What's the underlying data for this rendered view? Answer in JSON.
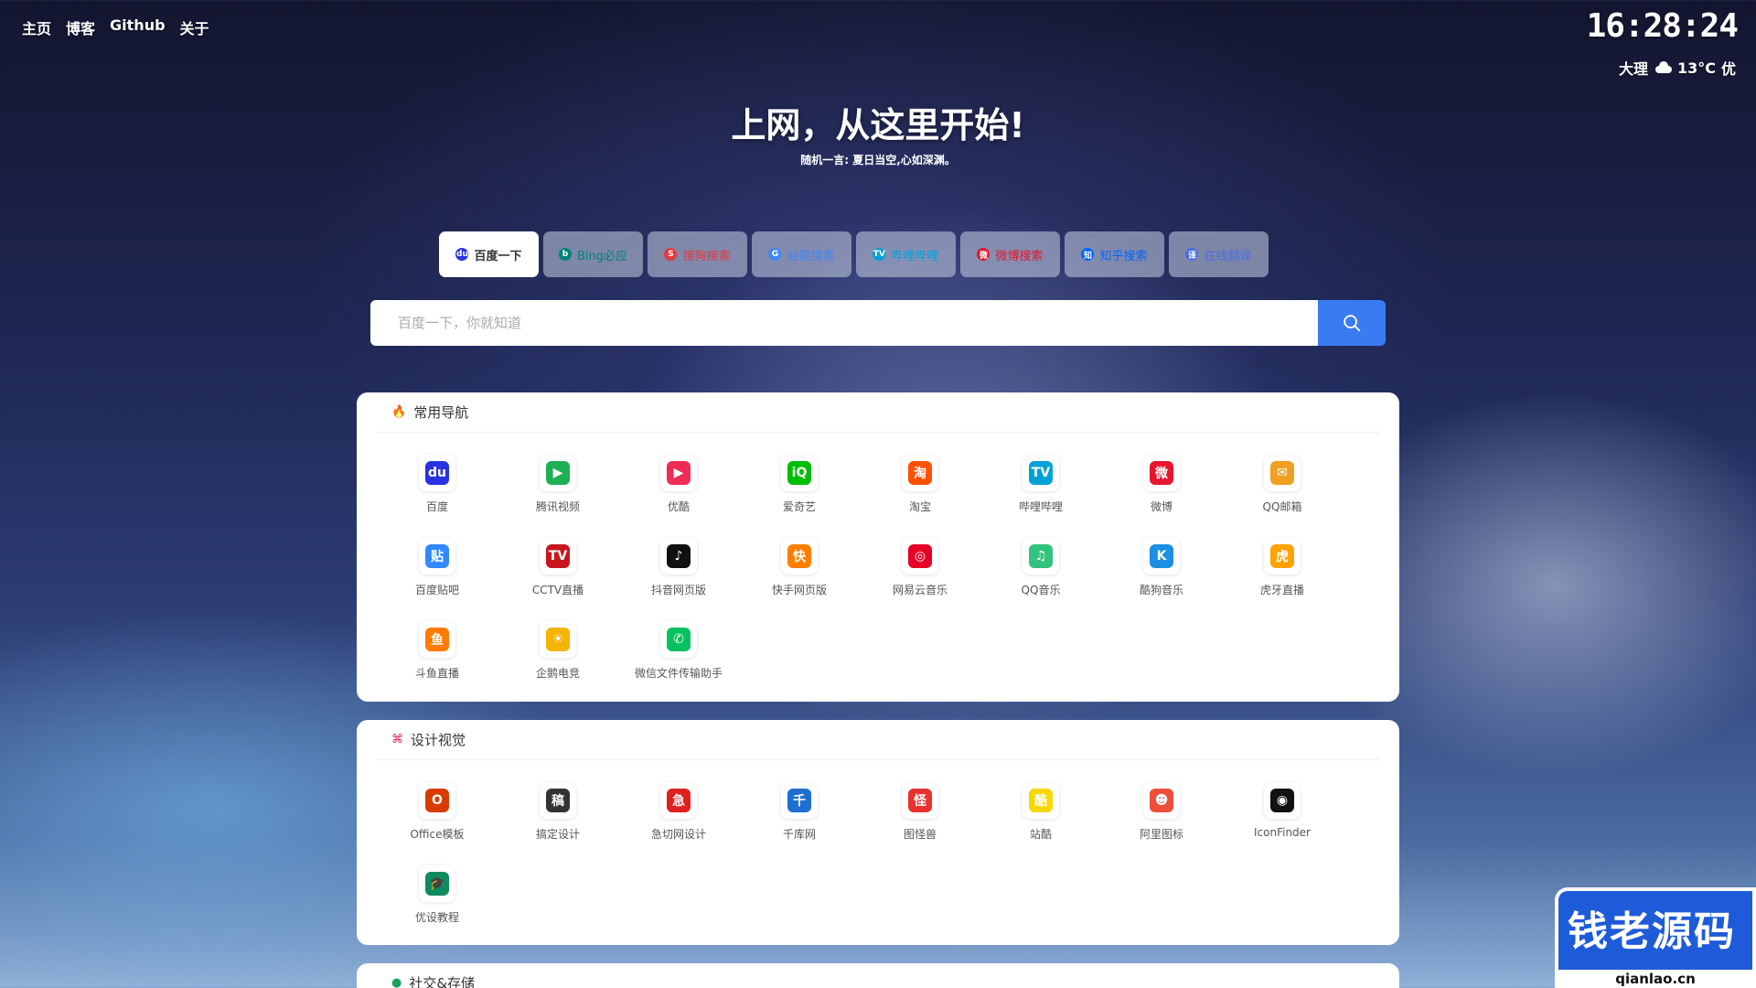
{
  "nav": [
    "主页",
    "博客",
    "Github",
    "关于"
  ],
  "clock": "16:28:24",
  "weather": {
    "city": "大理",
    "temp": "13°C",
    "aqi": "优"
  },
  "hero": {
    "title": "上网，从这里开始!",
    "subtitle": "随机一言: 夏日当空,心如深渊。"
  },
  "engines": [
    {
      "label": "百度一下",
      "active": true,
      "color": "#2932e1",
      "glyph": "du"
    },
    {
      "label": "Bing必应",
      "active": false,
      "color": "#008373",
      "glyph": "b"
    },
    {
      "label": "搜狗搜索",
      "active": false,
      "color": "#e4393c",
      "glyph": "S"
    },
    {
      "label": "谷歌搜索",
      "active": false,
      "color": "#4285f4",
      "glyph": "G"
    },
    {
      "label": "哔哩哔哩",
      "active": false,
      "color": "#00a1d6",
      "glyph": "TV"
    },
    {
      "label": "微博搜索",
      "active": false,
      "color": "#e6162d",
      "glyph": "微"
    },
    {
      "label": "知乎搜索",
      "active": false,
      "color": "#0066ff",
      "glyph": "知"
    },
    {
      "label": "在线翻译",
      "active": false,
      "color": "#4a6ee0",
      "glyph": "译"
    }
  ],
  "search": {
    "placeholder": "百度一下，你就知道"
  },
  "sections": [
    {
      "title": "常用导航",
      "icon": "fire-icon",
      "sites": [
        {
          "name": "百度",
          "icon": "baidu-icon",
          "color": "#2932e1",
          "glyph": "du"
        },
        {
          "name": "腾讯视频",
          "icon": "tencent-video-icon",
          "color": "#1fb055",
          "glyph": "▶"
        },
        {
          "name": "优酷",
          "icon": "youku-icon",
          "color": "#ee2d57",
          "glyph": "▶"
        },
        {
          "name": "爱奇艺",
          "icon": "iqiyi-icon",
          "color": "#00be06",
          "glyph": "iQ"
        },
        {
          "name": "淘宝",
          "icon": "taobao-icon",
          "color": "#ff5000",
          "glyph": "淘"
        },
        {
          "name": "哔哩哔哩",
          "icon": "bilibili-icon",
          "color": "#00a1d6",
          "glyph": "TV"
        },
        {
          "name": "微博",
          "icon": "weibo-icon",
          "color": "#e6162d",
          "glyph": "微"
        },
        {
          "name": "QQ邮箱",
          "icon": "qq-mail-icon",
          "color": "#f0a020",
          "glyph": "✉"
        },
        {
          "name": "百度贴吧",
          "icon": "tieba-icon",
          "color": "#3388ff",
          "glyph": "贴"
        },
        {
          "name": "CCTV直播",
          "icon": "cctv-icon",
          "color": "#c8161d",
          "glyph": "TV"
        },
        {
          "name": "抖音网页版",
          "icon": "douyin-icon",
          "color": "#111111",
          "glyph": "♪"
        },
        {
          "name": "快手网页版",
          "icon": "kuaishou-icon",
          "color": "#ff7e00",
          "glyph": "快"
        },
        {
          "name": "网易云音乐",
          "icon": "netease-music-icon",
          "color": "#e60026",
          "glyph": "◎"
        },
        {
          "name": "QQ音乐",
          "icon": "qq-music-icon",
          "color": "#31c27c",
          "glyph": "♫"
        },
        {
          "name": "酷狗音乐",
          "icon": "kugou-icon",
          "color": "#1a8fe3",
          "glyph": "K"
        },
        {
          "name": "虎牙直播",
          "icon": "huya-icon",
          "color": "#ffa200",
          "glyph": "虎"
        },
        {
          "name": "斗鱼直播",
          "icon": "douyu-icon",
          "color": "#ff7b00",
          "glyph": "鱼"
        },
        {
          "name": "企鹅电竞",
          "icon": "penguin-esports-icon",
          "color": "#f5b400",
          "glyph": "☀"
        },
        {
          "name": "微信文件传输助手",
          "icon": "wechat-icon",
          "color": "#07c160",
          "glyph": "✆"
        }
      ]
    },
    {
      "title": "设计视觉",
      "icon": "design-icon",
      "sites": [
        {
          "name": "Office模板",
          "icon": "office-icon",
          "color": "#d83b01",
          "glyph": "O"
        },
        {
          "name": "搞定设计",
          "icon": "gaoding-icon",
          "color": "#333333",
          "glyph": "稿"
        },
        {
          "name": "急切网设计",
          "icon": "jiqie-icon",
          "color": "#e02020",
          "glyph": "急"
        },
        {
          "name": "千库网",
          "icon": "qianku-icon",
          "color": "#1f6fd1",
          "glyph": "千"
        },
        {
          "name": "图怪兽",
          "icon": "tuguaishou-icon",
          "color": "#e8322e",
          "glyph": "怪"
        },
        {
          "name": "站酷",
          "icon": "zcool-icon",
          "color": "#f7d700",
          "glyph": "酷"
        },
        {
          "name": "阿里图标",
          "icon": "iconfont-icon",
          "color": "#ee4f3a",
          "glyph": "☻"
        },
        {
          "name": "IconFinder",
          "icon": "iconfinder-icon",
          "color": "#111111",
          "glyph": "◉"
        },
        {
          "name": "优设教程",
          "icon": "uisdc-icon",
          "color": "#0f8b5e",
          "glyph": "🎓"
        }
      ]
    },
    {
      "title": "社交&存储",
      "icon": "social-icon",
      "sites": []
    }
  ],
  "watermark": {
    "text": "钱老源码",
    "url": "qianlao.cn"
  }
}
